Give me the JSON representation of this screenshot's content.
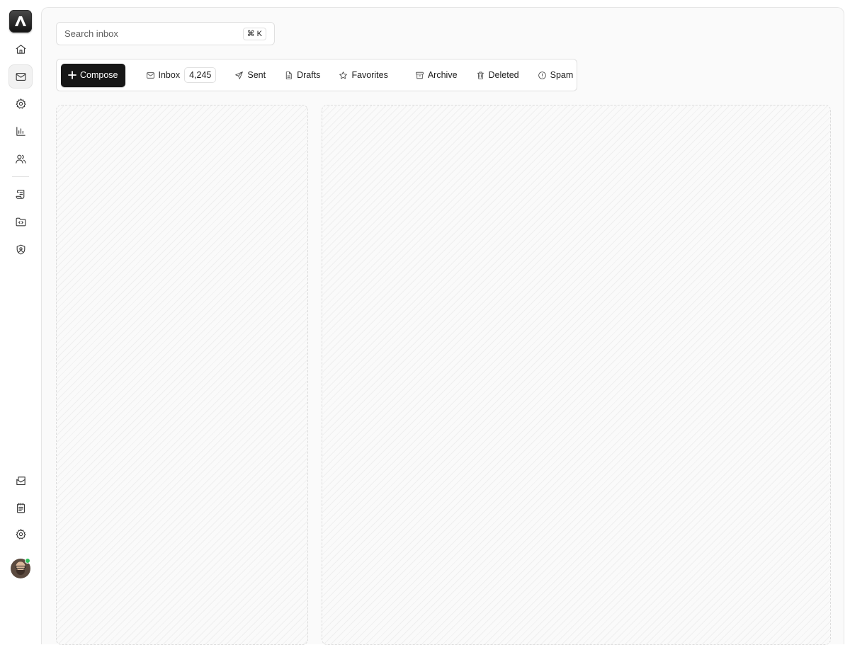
{
  "rail": {
    "logo": "app-logo",
    "nav_items": [
      {
        "name": "home-icon",
        "active": false
      },
      {
        "name": "mail-icon",
        "active": true
      },
      {
        "name": "settings-icon",
        "active": false
      },
      {
        "name": "bar-chart-icon",
        "active": false
      },
      {
        "name": "users-icon",
        "active": false
      }
    ],
    "tool_items": [
      "scroll-icon",
      "folder-code-icon",
      "shield-user-icon"
    ],
    "footer_items": [
      "mail-open-icon",
      "notepad-icon",
      "settings-icon"
    ],
    "avatar": {
      "status": "online",
      "status_color": "#2fbf5b"
    }
  },
  "search": {
    "placeholder": "Search inbox",
    "shortcut": "⌘ K"
  },
  "toolbar": {
    "compose_label": "Compose",
    "tabs": [
      {
        "label": "Inbox",
        "icon": "mail-icon",
        "count": "4,245"
      },
      {
        "label": "Sent",
        "icon": "send-icon"
      },
      {
        "label": "Drafts",
        "icon": "file-icon"
      },
      {
        "label": "Favorites",
        "icon": "star-icon"
      },
      {
        "label": "Archive",
        "icon": "archive-icon"
      },
      {
        "label": "Deleted",
        "icon": "trash-icon"
      },
      {
        "label": "Spam",
        "icon": "alert-circle-icon"
      }
    ]
  },
  "colors": {
    "accent": "#171717",
    "background": "#fafafa",
    "border": "#e0e0e0"
  }
}
